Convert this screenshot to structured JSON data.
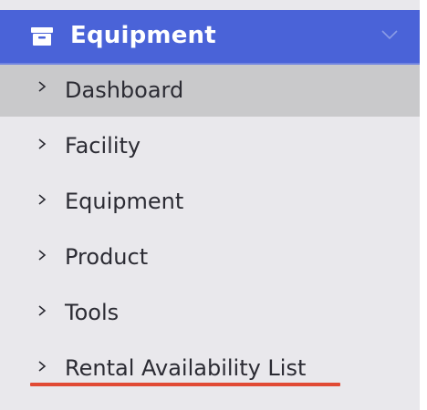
{
  "header": {
    "title": "Equipment",
    "icon": "archive-box-icon",
    "toggle_icon": "chevron-down-icon"
  },
  "menu": {
    "items": [
      {
        "label": "Dashboard",
        "active": true
      },
      {
        "label": "Facility",
        "active": false
      },
      {
        "label": "Equipment",
        "active": false
      },
      {
        "label": "Product",
        "active": false
      },
      {
        "label": "Tools",
        "active": false
      },
      {
        "label": "Rental Availability List",
        "active": false
      }
    ]
  },
  "colors": {
    "header_bg": "#4a63d8",
    "sidebar_bg": "#e9e8ec",
    "active_bg": "#c9c9cb",
    "annotation_underline": "#e14a34"
  }
}
